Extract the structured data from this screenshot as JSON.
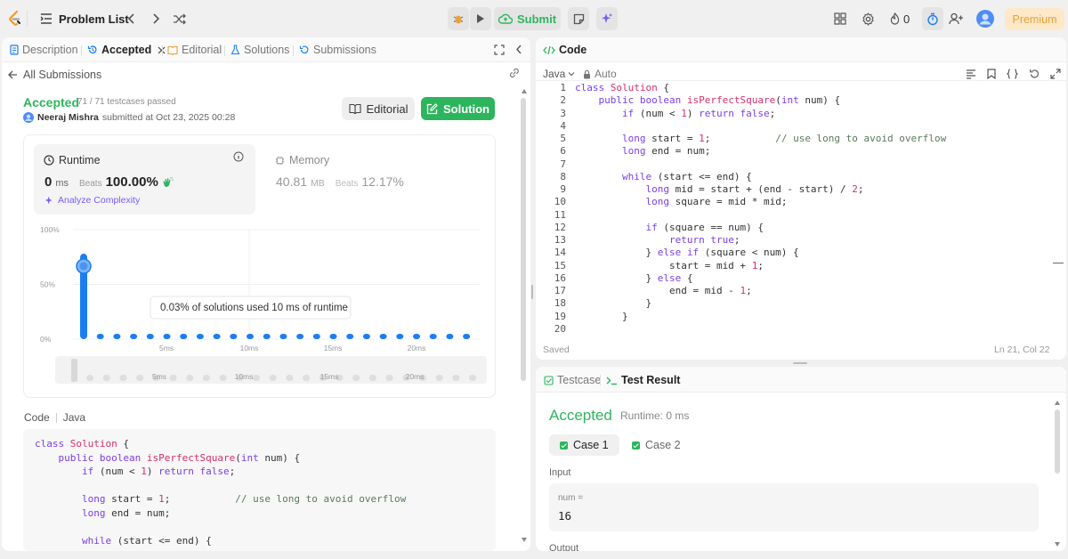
{
  "topbar": {
    "problem_list": "Problem List",
    "submit": "Submit",
    "streak": "0",
    "premium": "Premium"
  },
  "left": {
    "tabs": [
      "Description",
      "Accepted",
      "Editorial",
      "Solutions",
      "Submissions"
    ],
    "all_submissions": "All Submissions",
    "status": "Accepted",
    "testcases": "71 / 71 testcases passed",
    "user": "Neeraj Mishra",
    "submitted_at": "submitted at Oct 23, 2025 00:28",
    "editorial_btn": "Editorial",
    "solution_btn": "Solution",
    "runtime_label": "Runtime",
    "runtime_value": "0",
    "runtime_unit": "ms",
    "beats_label": "Beats",
    "runtime_beats": "100.00%",
    "memory_label": "Memory",
    "memory_value": "40.81",
    "memory_unit": "MB",
    "memory_beats": "12.17%",
    "analyze": "Analyze Complexity",
    "code_label": "Code",
    "code_lang": "Java"
  },
  "chart_data": {
    "type": "bar",
    "y_ticks": [
      "100%",
      "50%",
      "0%"
    ],
    "x_ticks": [
      "5ms",
      "10ms",
      "15ms",
      "20ms"
    ],
    "ylim": [
      0,
      100
    ],
    "values": [
      78,
      2,
      2,
      1,
      1,
      1,
      1,
      1,
      1,
      1,
      1,
      1,
      1,
      1,
      1,
      1,
      1,
      1,
      1,
      1,
      1,
      1,
      1,
      1
    ],
    "tooltip": "0.03% of solutions used 10 ms of runtime",
    "overview_ticks": [
      "5ms",
      "10ms",
      "15ms",
      "20ms"
    ]
  },
  "code_lines": [
    "class Solution {",
    "    public boolean isPerfectSquare(int num) {",
    "        if (num < 1) return false;",
    "",
    "        long start = 1;           // use long to avoid overflow",
    "        long end = num;",
    "",
    "        while (start <= end) {"
  ],
  "editor": {
    "title": "Code",
    "lang": "Java",
    "auto": "Auto",
    "saved": "Saved",
    "cursor": "Ln 21, Col 22",
    "line_numbers": [
      "1",
      "2",
      "3",
      "4",
      "5",
      "6",
      "7",
      "8",
      "9",
      "10",
      "11",
      "12",
      "13",
      "14",
      "15",
      "16",
      "17",
      "18",
      "19",
      "20"
    ],
    "lines": [
      "class Solution {",
      "    public boolean isPerfectSquare(int num) {",
      "        if (num < 1) return false;",
      "",
      "        long start = 1;           // use long to avoid overflow",
      "        long end = num;",
      "",
      "        while (start <= end) {",
      "            long mid = start + (end - start) / 2;",
      "            long square = mid * mid;",
      "",
      "            if (square == num) {",
      "                return true;",
      "            } else if (square < num) {",
      "                start = mid + 1;",
      "            } else {",
      "                end = mid - 1;",
      "            }",
      "        }",
      ""
    ]
  },
  "result": {
    "testcase_tab": "Testcase",
    "result_tab": "Test Result",
    "status": "Accepted",
    "runtime": "Runtime: 0 ms",
    "cases": [
      "Case 1",
      "Case 2"
    ],
    "input_label": "Input",
    "var_name": "num =",
    "var_value": "16",
    "output_label": "Output"
  }
}
